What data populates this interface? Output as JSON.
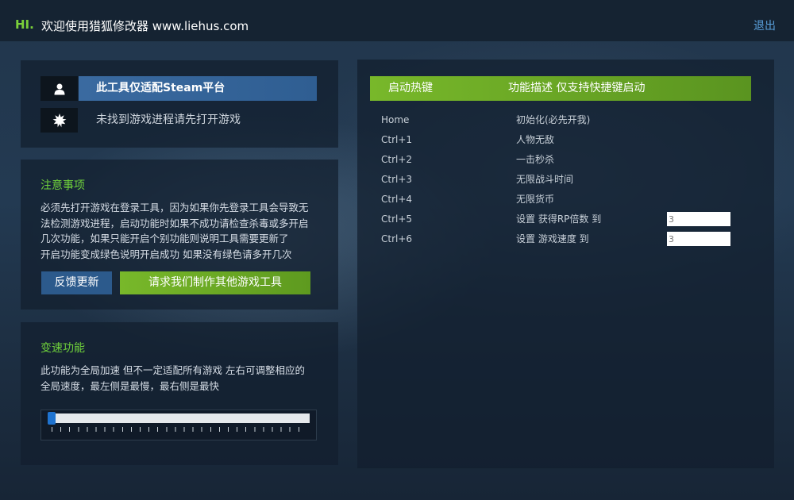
{
  "titlebar": {
    "hi": "HI.",
    "title": "欢迎使用猎狐修改器 www.liehus.com",
    "exit_label": "退出"
  },
  "info": {
    "steam_label": "此工具仅适配Steam平台",
    "status_text": "未找到游戏进程请先打开游戏",
    "user_icon": "user-icon",
    "status_icon": "gear-icon"
  },
  "notice": {
    "heading": "注意事项",
    "lines": [
      "必须先打开游戏在登录工具，因为如果你先登录工具会导致无",
      "法检测游戏进程，启动功能时如果不成功请检查杀毒或多开启",
      "几次功能，如果只能开启个别功能则说明工具需要更新了",
      "开启功能变成绿色说明开启成功 如果没有绿色请多开几次"
    ],
    "feedback_button": "反馈更新",
    "request_button": "请求我们制作其他游戏工具"
  },
  "speed": {
    "heading": "变速功能",
    "lines": [
      "此功能为全局加速 但不一定适配所有游戏 左右可调整相应的",
      "全局速度，最左侧是最慢，最右侧是最快"
    ],
    "slider_value": 0
  },
  "hotkeys": {
    "header_key": "启动热键",
    "header_desc": "功能描述 仅支持快捷键启动",
    "rows": [
      {
        "key": "Home",
        "desc": "初始化(必先开我)"
      },
      {
        "key": "Ctrl+1",
        "desc": "人物无敌"
      },
      {
        "key": "Ctrl+2",
        "desc": "一击秒杀"
      },
      {
        "key": "Ctrl+3",
        "desc": "无限战斗时间"
      },
      {
        "key": "Ctrl+4",
        "desc": "无限货币"
      },
      {
        "key": "Ctrl+5",
        "desc": "设置 获得RP倍数 到",
        "input_placeholder": "3"
      },
      {
        "key": "Ctrl+6",
        "desc": "设置 游戏速度 到",
        "input_placeholder": "3"
      }
    ]
  },
  "colors": {
    "accent_green": "#78b82a",
    "accent_blue": "#2f5e92",
    "link_blue": "#5aa0dc"
  }
}
